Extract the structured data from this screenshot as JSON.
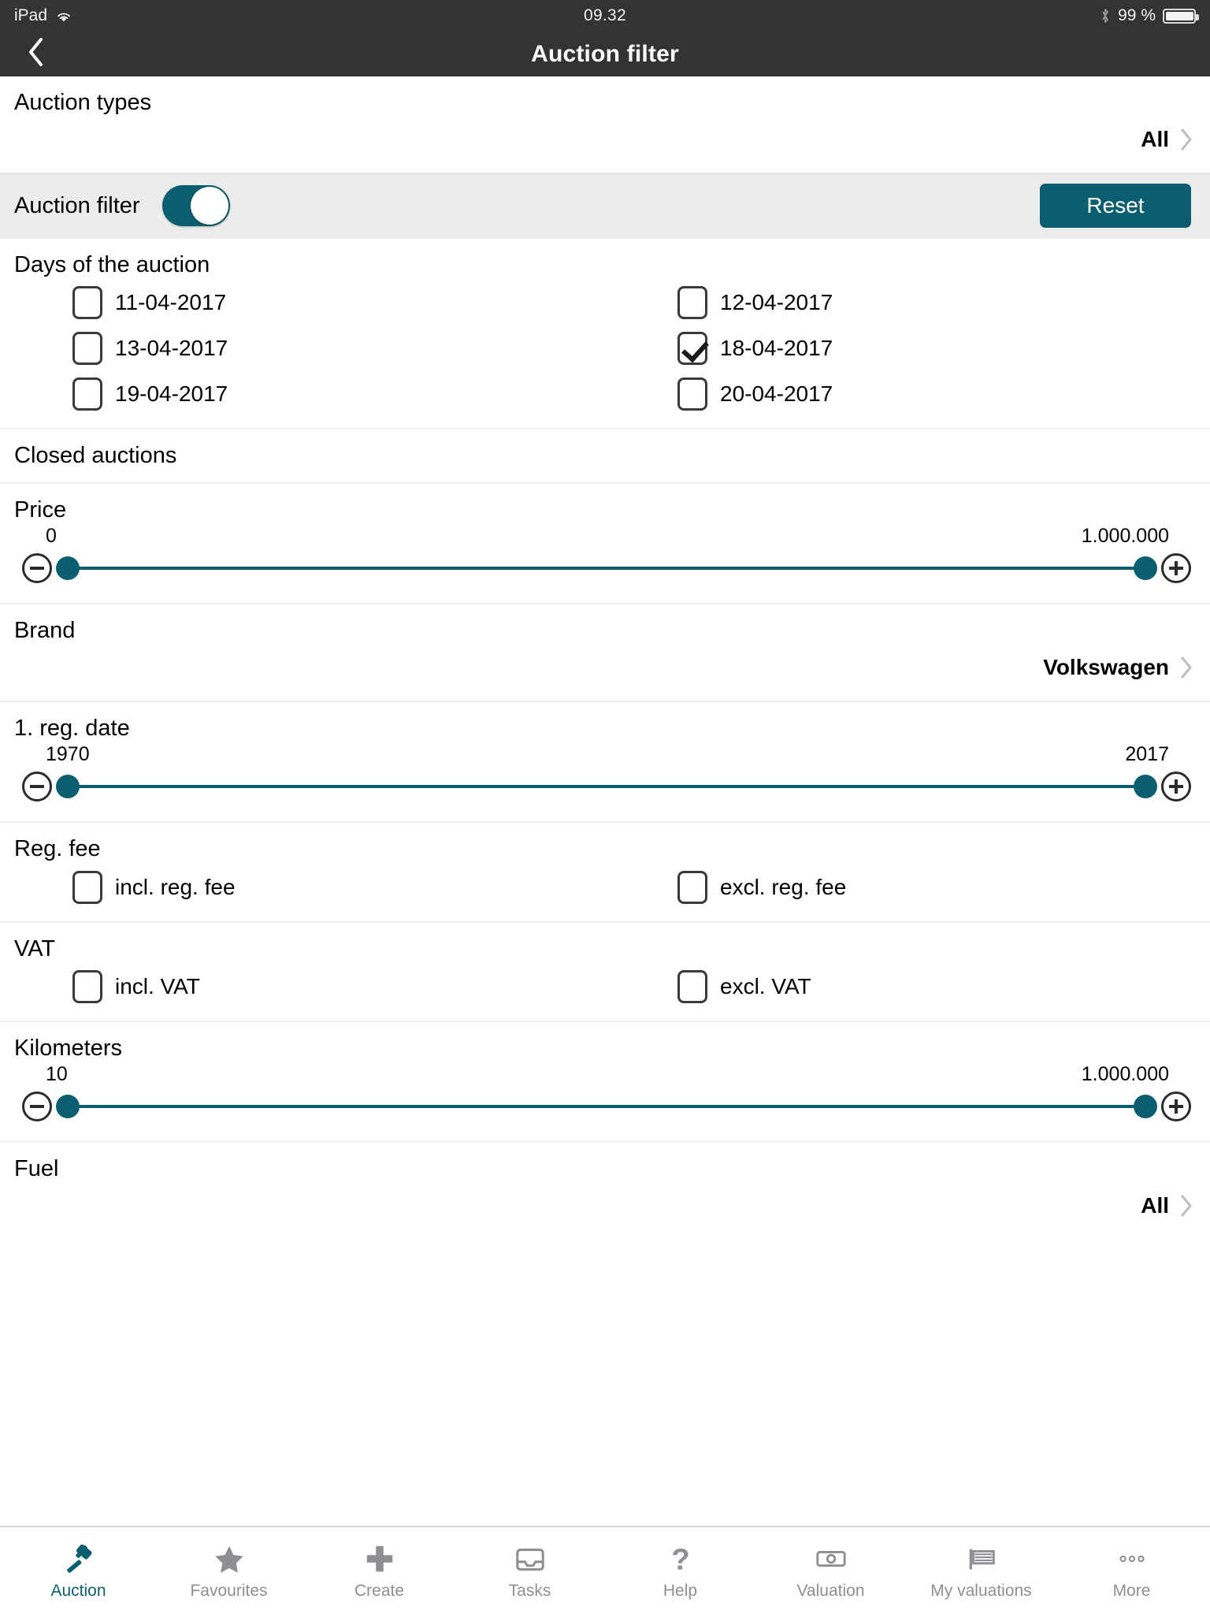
{
  "status_bar": {
    "device": "iPad",
    "wifi_icon": "wifi-icon",
    "time": "09.32",
    "bluetooth_icon": "bluetooth-icon",
    "battery_percent": "99 %",
    "battery_icon": "battery-icon"
  },
  "nav": {
    "back_icon": "chevron-left-icon",
    "title": "Auction filter"
  },
  "sections": {
    "auction_types": {
      "title": "Auction types",
      "value": "All",
      "chevron_icon": "chevron-right-icon"
    },
    "auction_filter": {
      "label": "Auction filter",
      "toggle_state": "on",
      "reset_label": "Reset"
    },
    "days": {
      "title": "Days of the auction",
      "items": [
        {
          "label": "11-04-2017",
          "checked": false
        },
        {
          "label": "12-04-2017",
          "checked": false
        },
        {
          "label": "13-04-2017",
          "checked": false
        },
        {
          "label": "18-04-2017",
          "checked": true
        },
        {
          "label": "19-04-2017",
          "checked": false
        },
        {
          "label": "20-04-2017",
          "checked": false
        }
      ]
    },
    "closed_auctions": {
      "title": "Closed auctions"
    },
    "price": {
      "title": "Price",
      "min": "0",
      "max": "1.000.000",
      "minus_icon": "minus-circle-icon",
      "plus_icon": "plus-circle-icon"
    },
    "brand": {
      "title": "Brand",
      "value": "Volkswagen",
      "chevron_icon": "chevron-right-icon"
    },
    "reg_date": {
      "title": "1. reg. date",
      "min": "1970",
      "max": "2017",
      "minus_icon": "minus-circle-icon",
      "plus_icon": "plus-circle-icon"
    },
    "reg_fee": {
      "title": "Reg. fee",
      "items": [
        {
          "label": "incl. reg. fee",
          "checked": false
        },
        {
          "label": "excl. reg. fee",
          "checked": false
        }
      ]
    },
    "vat": {
      "title": "VAT",
      "items": [
        {
          "label": "incl. VAT",
          "checked": false
        },
        {
          "label": "excl. VAT",
          "checked": false
        }
      ]
    },
    "kilometers": {
      "title": "Kilometers",
      "min": "10",
      "max": "1.000.000",
      "minus_icon": "minus-circle-icon",
      "plus_icon": "plus-circle-icon"
    },
    "fuel": {
      "title": "Fuel",
      "value": "All",
      "chevron_icon": "chevron-right-icon"
    }
  },
  "tabbar": {
    "items": [
      {
        "label": "Auction",
        "icon": "hammer-icon",
        "active": true
      },
      {
        "label": "Favourites",
        "icon": "star-icon",
        "active": false
      },
      {
        "label": "Create",
        "icon": "plus-icon",
        "active": false
      },
      {
        "label": "Tasks",
        "icon": "inbox-icon",
        "active": false
      },
      {
        "label": "Help",
        "icon": "question-icon",
        "active": false
      },
      {
        "label": "Valuation",
        "icon": "banknote-icon",
        "active": false
      },
      {
        "label": "My valuations",
        "icon": "flag-icon",
        "active": false
      },
      {
        "label": "More",
        "icon": "ellipsis-icon",
        "active": false
      }
    ]
  },
  "colors": {
    "accent": "#0b5e70",
    "bar": "#333333",
    "group": "#ececec"
  }
}
